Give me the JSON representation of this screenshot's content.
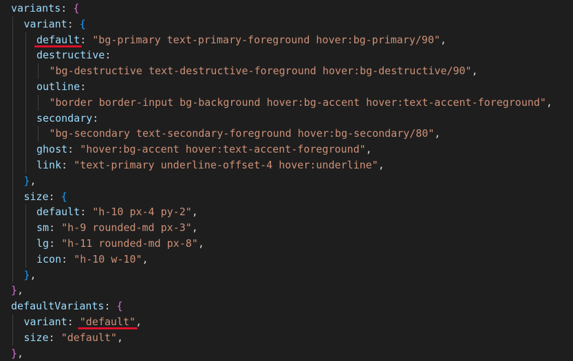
{
  "lines": [
    {
      "id": "l1",
      "indent": 0,
      "parts": [
        {
          "t": "variants",
          "c": "prop"
        },
        {
          "t": ": ",
          "c": "punc"
        },
        {
          "t": "{",
          "c": "brace-o"
        }
      ]
    },
    {
      "id": "l2",
      "indent": 1,
      "parts": [
        {
          "t": "variant",
          "c": "prop"
        },
        {
          "t": ": ",
          "c": "punc"
        },
        {
          "t": "{",
          "c": "brace-b"
        }
      ]
    },
    {
      "id": "l3",
      "indent": 2,
      "parts": [
        {
          "t": "default",
          "c": "prop"
        },
        {
          "t": ": ",
          "c": "punc"
        },
        {
          "t": "\"bg-primary text-primary-foreground hover:bg-primary/90\"",
          "c": "str"
        },
        {
          "t": ",",
          "c": "punc"
        }
      ]
    },
    {
      "id": "l4",
      "indent": 2,
      "parts": [
        {
          "t": "destructive",
          "c": "prop"
        },
        {
          "t": ":",
          "c": "punc"
        }
      ]
    },
    {
      "id": "l5",
      "indent": 3,
      "parts": [
        {
          "t": "\"bg-destructive text-destructive-foreground hover:bg-destructive/90\"",
          "c": "str"
        },
        {
          "t": ",",
          "c": "punc"
        }
      ]
    },
    {
      "id": "l6",
      "indent": 2,
      "parts": [
        {
          "t": "outline",
          "c": "prop"
        },
        {
          "t": ":",
          "c": "punc"
        }
      ]
    },
    {
      "id": "l7",
      "indent": 3,
      "parts": [
        {
          "t": "\"border border-input bg-background hover:bg-accent hover:text-accent-foreground\"",
          "c": "str"
        },
        {
          "t": ",",
          "c": "punc"
        }
      ]
    },
    {
      "id": "l8",
      "indent": 2,
      "parts": [
        {
          "t": "secondary",
          "c": "prop"
        },
        {
          "t": ":",
          "c": "punc"
        }
      ]
    },
    {
      "id": "l9",
      "indent": 3,
      "parts": [
        {
          "t": "\"bg-secondary text-secondary-foreground hover:bg-secondary/80\"",
          "c": "str"
        },
        {
          "t": ",",
          "c": "punc"
        }
      ]
    },
    {
      "id": "l10",
      "indent": 2,
      "parts": [
        {
          "t": "ghost",
          "c": "prop"
        },
        {
          "t": ": ",
          "c": "punc"
        },
        {
          "t": "\"hover:bg-accent hover:text-accent-foreground\"",
          "c": "str"
        },
        {
          "t": ",",
          "c": "punc"
        }
      ]
    },
    {
      "id": "l11",
      "indent": 2,
      "parts": [
        {
          "t": "link",
          "c": "prop"
        },
        {
          "t": ": ",
          "c": "punc"
        },
        {
          "t": "\"text-primary underline-offset-4 hover:underline\"",
          "c": "str"
        },
        {
          "t": ",",
          "c": "punc"
        }
      ]
    },
    {
      "id": "l12",
      "indent": 1,
      "parts": [
        {
          "t": "}",
          "c": "brace-b"
        },
        {
          "t": ",",
          "c": "punc"
        }
      ]
    },
    {
      "id": "l13",
      "indent": 1,
      "parts": [
        {
          "t": "size",
          "c": "prop"
        },
        {
          "t": ": ",
          "c": "punc"
        },
        {
          "t": "{",
          "c": "brace-b"
        }
      ]
    },
    {
      "id": "l14",
      "indent": 2,
      "parts": [
        {
          "t": "default",
          "c": "prop"
        },
        {
          "t": ": ",
          "c": "punc"
        },
        {
          "t": "\"h-10 px-4 py-2\"",
          "c": "str"
        },
        {
          "t": ",",
          "c": "punc"
        }
      ]
    },
    {
      "id": "l15",
      "indent": 2,
      "parts": [
        {
          "t": "sm",
          "c": "prop"
        },
        {
          "t": ": ",
          "c": "punc"
        },
        {
          "t": "\"h-9 rounded-md px-3\"",
          "c": "str"
        },
        {
          "t": ",",
          "c": "punc"
        }
      ]
    },
    {
      "id": "l16",
      "indent": 2,
      "parts": [
        {
          "t": "lg",
          "c": "prop"
        },
        {
          "t": ": ",
          "c": "punc"
        },
        {
          "t": "\"h-11 rounded-md px-8\"",
          "c": "str"
        },
        {
          "t": ",",
          "c": "punc"
        }
      ]
    },
    {
      "id": "l17",
      "indent": 2,
      "parts": [
        {
          "t": "icon",
          "c": "prop"
        },
        {
          "t": ": ",
          "c": "punc"
        },
        {
          "t": "\"h-10 w-10\"",
          "c": "str"
        },
        {
          "t": ",",
          "c": "punc"
        }
      ]
    },
    {
      "id": "l18",
      "indent": 1,
      "parts": [
        {
          "t": "}",
          "c": "brace-b"
        },
        {
          "t": ",",
          "c": "punc"
        }
      ]
    },
    {
      "id": "l19",
      "indent": 0,
      "parts": [
        {
          "t": "}",
          "c": "brace-o"
        },
        {
          "t": ",",
          "c": "punc"
        }
      ]
    },
    {
      "id": "l20",
      "indent": 0,
      "parts": [
        {
          "t": "defaultVariants",
          "c": "prop"
        },
        {
          "t": ": ",
          "c": "punc"
        },
        {
          "t": "{",
          "c": "brace-o"
        }
      ]
    },
    {
      "id": "l21",
      "indent": 1,
      "parts": [
        {
          "t": "variant",
          "c": "prop"
        },
        {
          "t": ": ",
          "c": "punc"
        },
        {
          "t": "\"default\"",
          "c": "str"
        },
        {
          "t": ",",
          "c": "punc"
        }
      ]
    },
    {
      "id": "l22",
      "indent": 1,
      "parts": [
        {
          "t": "size",
          "c": "prop"
        },
        {
          "t": ": ",
          "c": "punc"
        },
        {
          "t": "\"default\"",
          "c": "str"
        },
        {
          "t": ",",
          "c": "punc"
        }
      ]
    },
    {
      "id": "l23",
      "indent": 0,
      "parts": [
        {
          "t": "}",
          "c": "brace-o"
        },
        {
          "t": ",",
          "c": "punc"
        }
      ]
    }
  ],
  "annotations": [
    {
      "name": "default-key-underline",
      "line": "l3",
      "part": 0,
      "color": "#e0112a"
    },
    {
      "name": "default-value-underline",
      "line": "l21",
      "part": 2,
      "color": "#e0112a"
    }
  ],
  "theme": {
    "background": "#1e1e1e",
    "property": "#9cdcfe",
    "string": "#ce9178",
    "punctuation": "#d4d4d4",
    "brace_level_1": "#da70d6",
    "brace_level_2": "#179fff",
    "indent_guide": "#404040",
    "annotation": "#e0112a"
  }
}
